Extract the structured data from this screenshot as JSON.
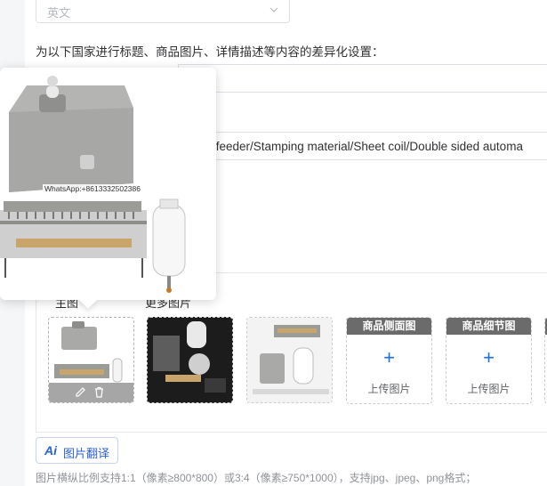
{
  "language_select": {
    "value": "英文"
  },
  "section": {
    "label": "为以下国家进行标题、商品图片、详情描述等内容的差异化设置："
  },
  "title_row": {
    "text": "il feeder/Stamping material/Sheet coil/Double sided automa"
  },
  "tabs": {
    "main": "主图",
    "more": "更多图片"
  },
  "upload_slots": [
    {
      "header": "商品侧面图",
      "label": "上传图片",
      "plus": "+"
    },
    {
      "header": "商品细节图",
      "label": "上传图片",
      "plus": "+"
    }
  ],
  "preview": {
    "watermark": "WhatsApp:+8613332502386"
  },
  "translate_button": {
    "ai": "Ai",
    "label": "图片翻译"
  },
  "hint": "图片横纵比例支持1:1（像素≥800*800）或3:4（像素≥750*1000），支持jpg、jpeg、png格式；",
  "colors": {
    "accent": "#1f6fe0",
    "header_gray": "#6b6b6b"
  }
}
